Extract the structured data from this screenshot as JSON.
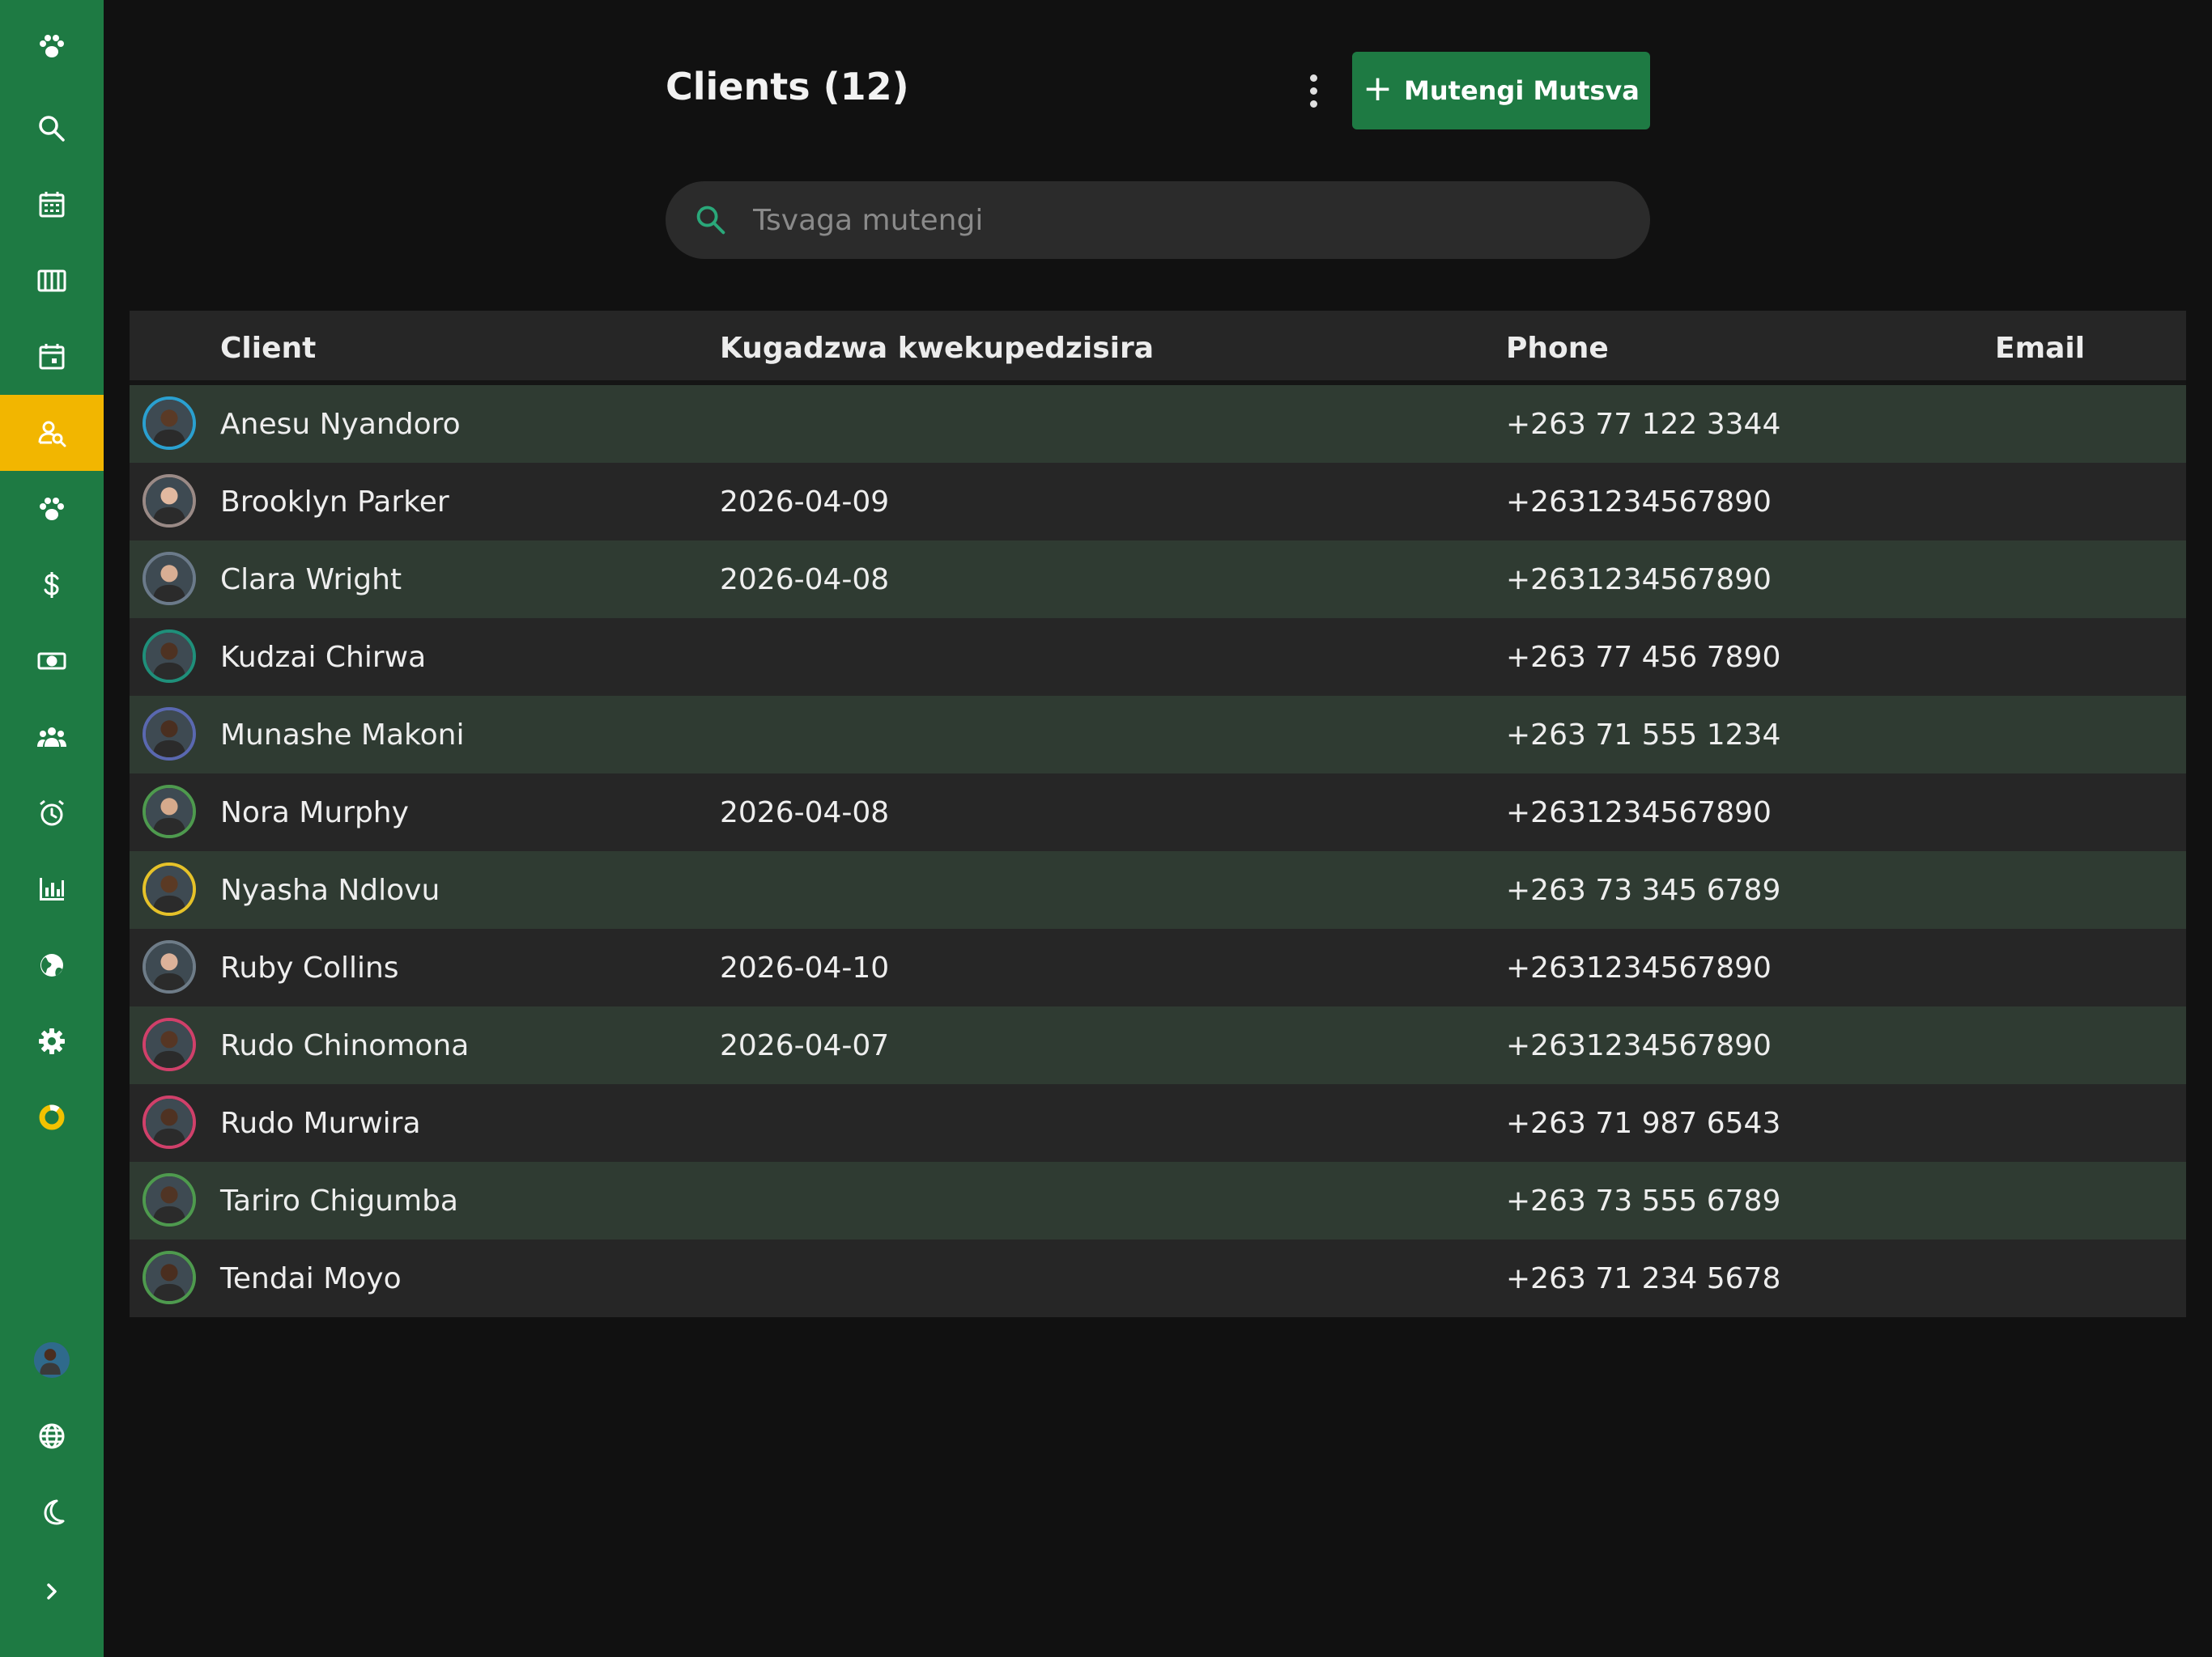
{
  "sidebar": {
    "items": [
      {
        "icon": "paw-logo-icon"
      },
      {
        "icon": "search-icon"
      },
      {
        "icon": "calendar-grid-icon"
      },
      {
        "icon": "columns-icon"
      },
      {
        "icon": "calendar-day-icon"
      },
      {
        "icon": "client-search-icon",
        "active": true
      },
      {
        "icon": "paw-icon"
      },
      {
        "icon": "dollar-icon"
      },
      {
        "icon": "cash-icon"
      },
      {
        "icon": "users-icon"
      },
      {
        "icon": "alarm-icon"
      },
      {
        "icon": "bar-chart-icon"
      },
      {
        "icon": "globe-earth-icon"
      },
      {
        "icon": "gear-icon"
      },
      {
        "icon": "donut-icon"
      }
    ],
    "bottom": [
      {
        "icon": "user-avatar"
      },
      {
        "icon": "language-globe-icon"
      },
      {
        "icon": "moon-icon"
      },
      {
        "icon": "chevron-right-icon"
      }
    ],
    "active_color": "#f2b600",
    "background_color": "#1e7a43"
  },
  "header": {
    "title": "Clients (12)",
    "new_button_label": "Mutengi Mutsva"
  },
  "search": {
    "placeholder": "Tsvaga mutengi",
    "value": ""
  },
  "table": {
    "headers": {
      "client": "Client",
      "last_booked": "Kugadzwa kwekupedzisira",
      "phone": "Phone",
      "email": "Email"
    },
    "rows": [
      {
        "name": "Anesu Nyandoro",
        "last_booked": "",
        "phone": "+263 77 122 3344",
        "email": "",
        "avatar_ring": "#2aa0d0",
        "avatar_skin": "#5a3a26"
      },
      {
        "name": "Brooklyn Parker",
        "last_booked": "2026-04-09",
        "phone": "+2631234567890",
        "email": "",
        "avatar_ring": "#9a8a86",
        "avatar_skin": "#e2b9a0"
      },
      {
        "name": "Clara Wright",
        "last_booked": "2026-04-08",
        "phone": "+2631234567890",
        "email": "",
        "avatar_ring": "#6b7a8a",
        "avatar_skin": "#d8ae94"
      },
      {
        "name": "Kudzai Chirwa",
        "last_booked": "",
        "phone": "+263 77 456 7890",
        "email": "",
        "avatar_ring": "#1f8f7a",
        "avatar_skin": "#4e3222"
      },
      {
        "name": "Munashe Makoni",
        "last_booked": "",
        "phone": "+263 71 555 1234",
        "email": "",
        "avatar_ring": "#5a68b0",
        "avatar_skin": "#4a2f20"
      },
      {
        "name": "Nora Murphy",
        "last_booked": "2026-04-08",
        "phone": "+2631234567890",
        "email": "",
        "avatar_ring": "#4e9a4e",
        "avatar_skin": "#d6aa8c"
      },
      {
        "name": "Nyasha Ndlovu",
        "last_booked": "",
        "phone": "+263 73 345 6789",
        "email": "",
        "avatar_ring": "#e6c229",
        "avatar_skin": "#5b3a24"
      },
      {
        "name": "Ruby Collins",
        "last_booked": "2026-04-10",
        "phone": "+2631234567890",
        "email": "",
        "avatar_ring": "#6e7c88",
        "avatar_skin": "#dcb29a"
      },
      {
        "name": "Rudo Chinomona",
        "last_booked": "2026-04-07",
        "phone": "+2631234567890",
        "email": "",
        "avatar_ring": "#d0406a",
        "avatar_skin": "#563624"
      },
      {
        "name": "Rudo Murwira",
        "last_booked": "",
        "phone": "+263 71 987 6543",
        "email": "",
        "avatar_ring": "#d0406a",
        "avatar_skin": "#4f3222"
      },
      {
        "name": "Tariro Chigumba",
        "last_booked": "",
        "phone": "+263 73 555 6789",
        "email": "",
        "avatar_ring": "#4e9a4e",
        "avatar_skin": "#503424"
      },
      {
        "name": "Tendai Moyo",
        "last_booked": "",
        "phone": "+263 71 234 5678",
        "email": "",
        "avatar_ring": "#4e9a4e",
        "avatar_skin": "#4a2e1f"
      }
    ]
  }
}
